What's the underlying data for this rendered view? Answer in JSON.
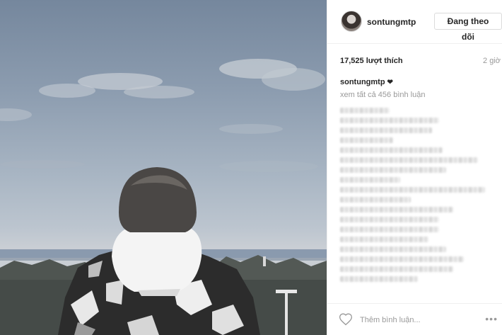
{
  "header": {
    "username": "sontungmtp",
    "follow_label": "Đang theo dõi"
  },
  "stats": {
    "likes": "17,525 lượt thích",
    "time_ago": "2 giờ"
  },
  "caption": {
    "username": "sontungmtp",
    "heart": "❤"
  },
  "comments": {
    "view_all": "xem tất cả 456 bình luận"
  },
  "footer": {
    "comment_placeholder": "Thêm bình luận...",
    "more": "•••"
  },
  "icons": {
    "like": "heart-outline-icon",
    "more": "more-options-icon",
    "avatar": "profile-avatar"
  }
}
